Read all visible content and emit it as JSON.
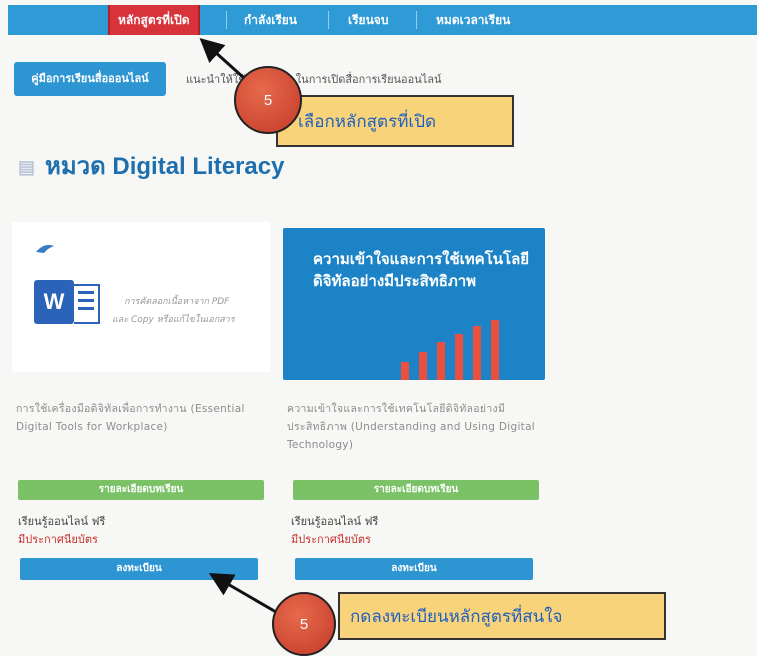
{
  "nav": {
    "items": [
      "หลักสูตรที่เปิด",
      "กำลังเรียน",
      "เรียนจบ",
      "หมดเวลาเรียน"
    ]
  },
  "guide": {
    "button_label": "คู่มือการเรียนสื่อออนไลน์",
    "text": "แนะนำให้ใช้ Chrome ในการเปิดสื่อการเรียนออนไลน์"
  },
  "section": {
    "title": "หมวด Digital Literacy"
  },
  "courses": [
    {
      "thumb_lines": [
        "การคัดลอกเนื้อหาจาก PDF",
        "และ Copy หรือแก้ไขในเอกสาร"
      ],
      "description": "การใช้เครื่องมือดิจิทัลเพื่อการทำงาน (Essential Digital Tools for Workplace)",
      "details_label": "รายละเอียดบทเรียน",
      "price": "เรียนรู้ออนไลน์ ฟรี",
      "certificate": "มีประกาศนียบัตร",
      "register_label": "ลงทะเบียน"
    },
    {
      "thumb_title": "ความเข้าใจและการใช้เทคโนโลยีดิจิทัลอย่างมีประสิทธิภาพ",
      "description": "ความเข้าใจและการใช้เทคโนโลยีดิจิทัลอย่างมีประสิทธิภาพ (Understanding and Using Digital Technology)",
      "details_label": "รายละเอียดบทเรียน",
      "price": "เรียนรู้ออนไลน์ ฟรี",
      "certificate": "มีประกาศนียบัตร",
      "register_label": "ลงทะเบียน"
    }
  ],
  "annotations": [
    {
      "step": "5",
      "text": "เลือกหลักสูตรที่เปิด"
    },
    {
      "step": "5",
      "text": "กดลงทะเบียนหลักสูตรที่สนใจ"
    }
  ],
  "colors": {
    "nav_bg": "#2e9ad6",
    "nav_active": "#d8323a",
    "details_btn": "#7bc267",
    "register_btn": "#2c95d2",
    "callout_bg": "#f9d37a",
    "badge": "#c43a2a"
  }
}
